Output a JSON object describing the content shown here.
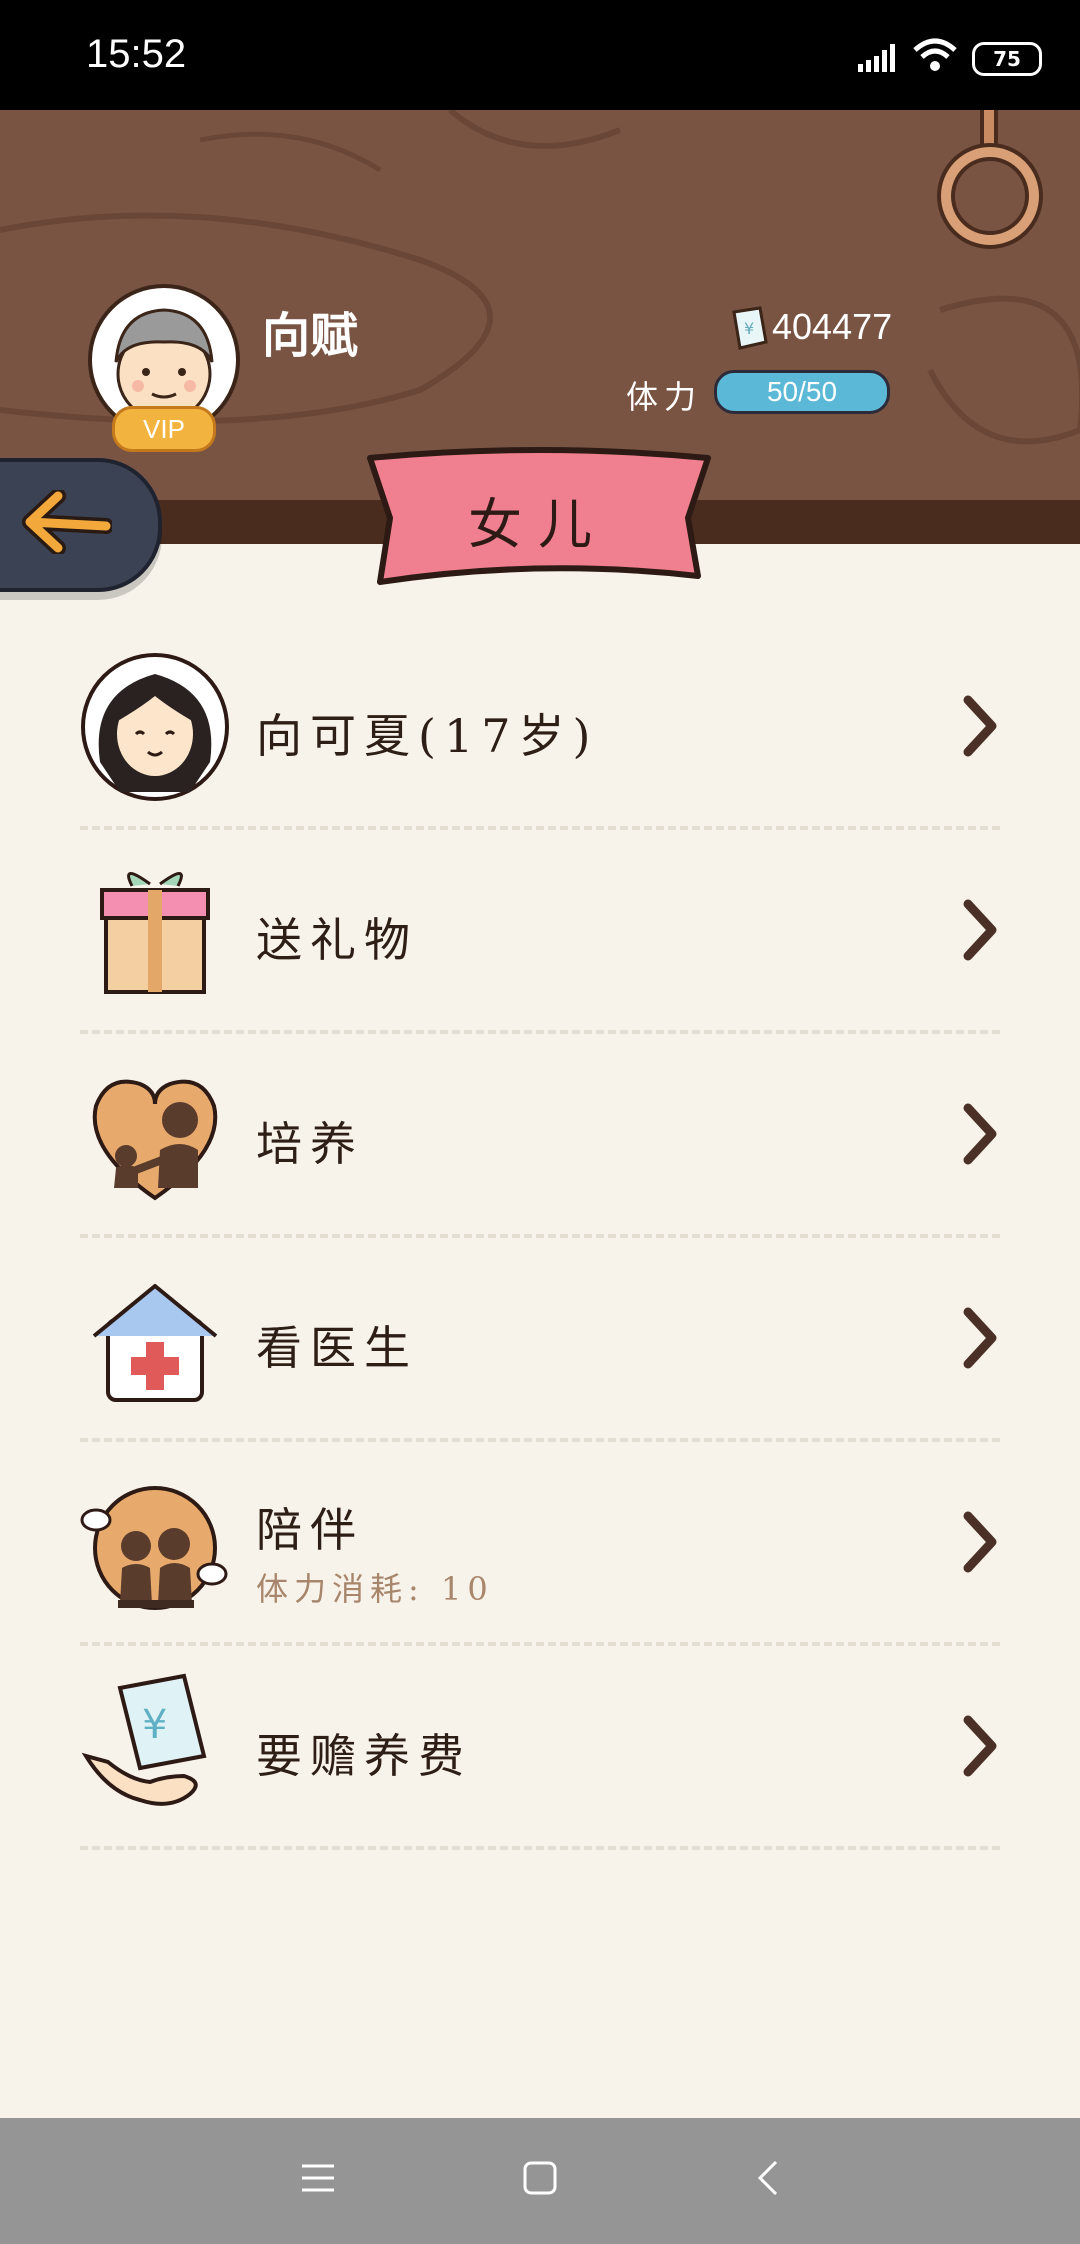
{
  "status_bar": {
    "time": "15:52",
    "battery": "75"
  },
  "header": {
    "player_name": "向赋",
    "vip_label": "VIP",
    "money": "404477",
    "stamina_label": "体力",
    "stamina_value": "50/50"
  },
  "page": {
    "title": "女儿"
  },
  "list": [
    {
      "label": "向可夏(17岁)",
      "sub": ""
    },
    {
      "label": "送礼物",
      "sub": ""
    },
    {
      "label": "培养",
      "sub": ""
    },
    {
      "label": "看医生",
      "sub": ""
    },
    {
      "label": "陪伴",
      "sub": "体力消耗: 10"
    },
    {
      "label": "要赡养费",
      "sub": ""
    }
  ],
  "colors": {
    "wood": "#7a5443",
    "banner": "#f07f8f",
    "stamina": "#5bb8d6",
    "vip": "#f2b43f"
  }
}
